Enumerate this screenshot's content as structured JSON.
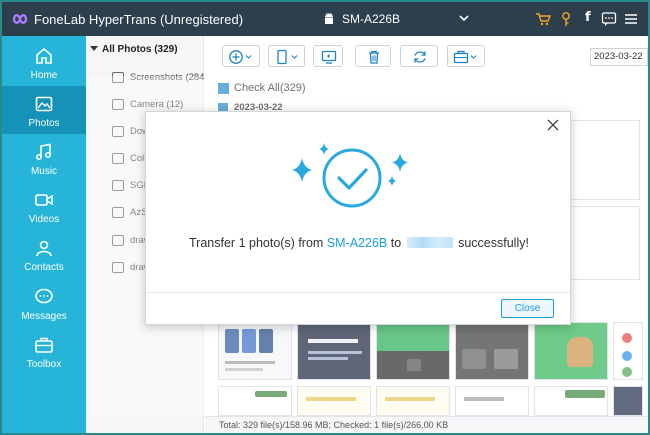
{
  "window": {
    "title": "FoneLab HyperTrans (Unregistered)",
    "device_name": "SM-A226B",
    "title_icons": [
      "cart-icon",
      "key-icon",
      "facebook-icon",
      "feedback-icon",
      "menu-icon"
    ],
    "facebook_glyph": "f"
  },
  "nav": {
    "items": [
      {
        "label": "Home",
        "icon": "home-icon"
      },
      {
        "label": "Photos",
        "icon": "photo-icon",
        "active": true
      },
      {
        "label": "Music",
        "icon": "music-icon"
      },
      {
        "label": "Videos",
        "icon": "video-icon"
      },
      {
        "label": "Contacts",
        "icon": "contacts-icon"
      },
      {
        "label": "Messages",
        "icon": "messages-icon"
      },
      {
        "label": "Toolbox",
        "icon": "toolbox-icon"
      }
    ]
  },
  "folders": {
    "header": "All Photos (329)",
    "items": [
      {
        "label": "Screenshots (284)"
      },
      {
        "label": "Camera (12)"
      },
      {
        "label": "Dow"
      },
      {
        "label": "Colle"
      },
      {
        "label": "SGP"
      },
      {
        "label": "AzS"
      },
      {
        "label": "draw"
      },
      {
        "label": "draw"
      }
    ]
  },
  "toolbar": {
    "date_value": "2023-03-22"
  },
  "content": {
    "check_all": "Check All(329)",
    "date_group": "2023-03-22"
  },
  "status": {
    "text": "Total: 329 file(s)/158.96 MB; Checked: 1 file(s)/266.00 KB"
  },
  "dialog": {
    "message_prefix": "Transfer 1 photo(s) from ",
    "device": "SM-A226B",
    "message_mid": " to ",
    "message_suffix": " successfully!",
    "close_button": "Close"
  },
  "colors": {
    "accent": "#26b4d8",
    "nav_active": "#1592b8",
    "title_bar": "#2d3e4c",
    "success": "#29a9e0",
    "cart_orange": "#f5a623"
  }
}
